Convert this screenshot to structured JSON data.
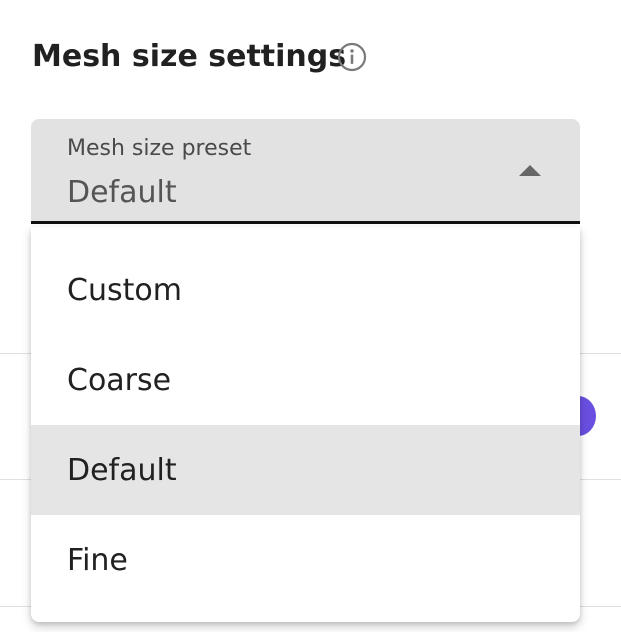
{
  "header": {
    "title": "Mesh size settings",
    "info_icon": "info-circle-icon"
  },
  "select": {
    "label": "Mesh size preset",
    "value": "Default",
    "caret_icon": "caret-up-icon"
  },
  "menu": {
    "items": [
      {
        "label": "Custom",
        "selected": false
      },
      {
        "label": "Coarse",
        "selected": false
      },
      {
        "label": "Default",
        "selected": true
      },
      {
        "label": "Fine",
        "selected": false
      }
    ]
  },
  "colors": {
    "field_background": "#e2e2e2",
    "selected_item_background": "#e5e5e5",
    "accent": "#6a4fe0",
    "text": "#212121"
  }
}
